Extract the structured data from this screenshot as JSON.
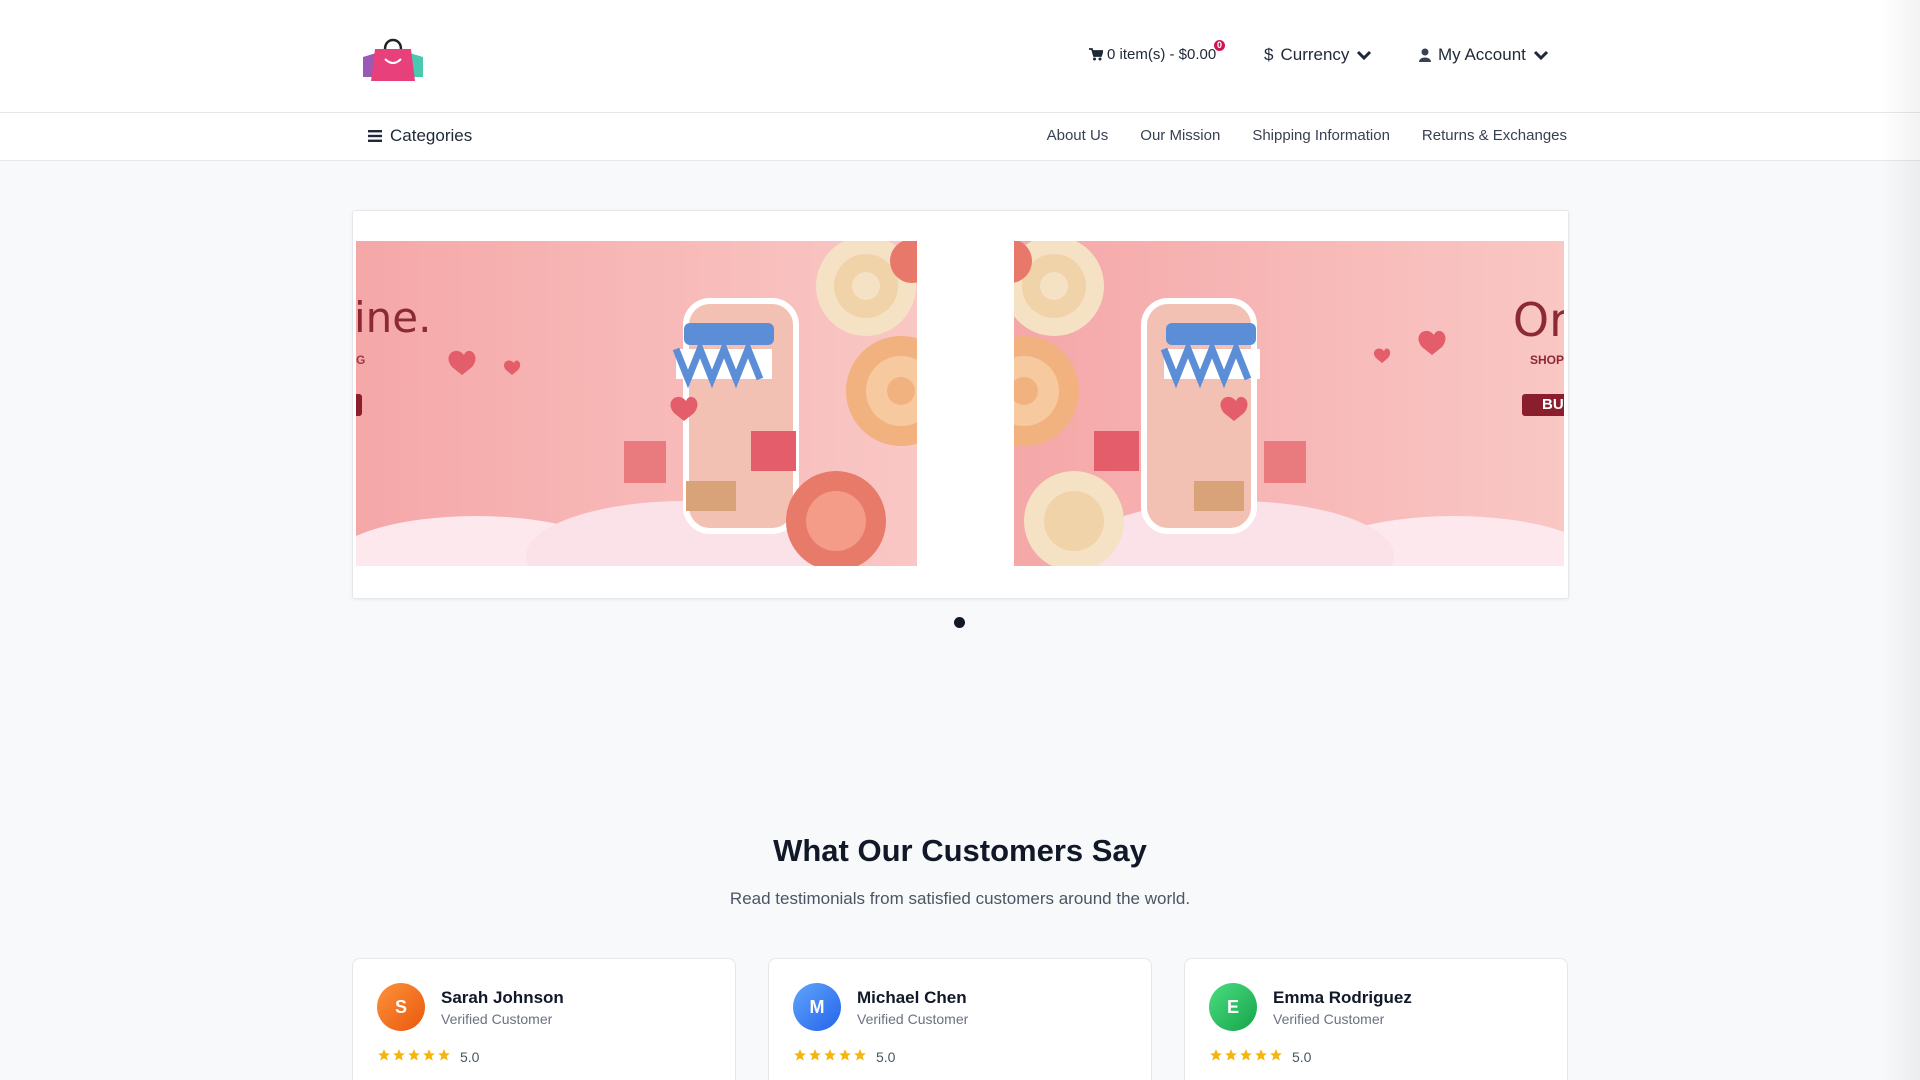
{
  "header": {
    "cart_text": "0 item(s) - $0.00",
    "cart_badge": "0",
    "currency_label": "Currency",
    "currency_symbol": "$",
    "account_label": "My Account"
  },
  "nav": {
    "categories_label": "Categories",
    "links": [
      "About Us",
      "Our Mission",
      "Shipping Information",
      "Returns & Exchanges"
    ]
  },
  "slider": {
    "left_banner_text": "ine.",
    "left_banner_small": "G",
    "right_banner_text": "Or",
    "right_banner_small": "SHOP",
    "right_banner_button": "BU"
  },
  "testimonials": {
    "title": "What Our Customers Say",
    "subtitle": "Read testimonials from satisfied customers around the world.",
    "cards": [
      {
        "initial": "S",
        "name": "Sarah Johnson",
        "role": "Verified Customer",
        "rating": "5.0",
        "color": "#f97316"
      },
      {
        "initial": "M",
        "name": "Michael Chen",
        "role": "Verified Customer",
        "rating": "5.0",
        "color": "#3b82f6"
      },
      {
        "initial": "E",
        "name": "Emma Rodriguez",
        "role": "Verified Customer",
        "rating": "5.0",
        "color": "#22c55e"
      }
    ]
  },
  "colors": {
    "accent": "#d4145a",
    "star": "#f5b50a",
    "banner_pink": "#f7b8b7"
  }
}
